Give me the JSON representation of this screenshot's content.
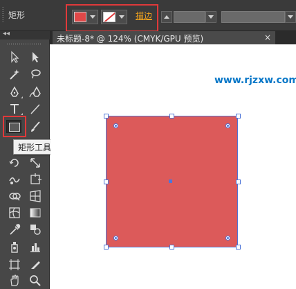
{
  "control_bar": {
    "tool_name": "矩形",
    "fill_color": "#e04848",
    "stroke": "none",
    "stroke_label": "描边"
  },
  "document_tab": {
    "title": "未标题-8* @ 124% (CMYK/GPU 预览)",
    "close": "×"
  },
  "tools_panel": {
    "collapse_glyph": "◂◂",
    "active_tool": "rectangle-tool",
    "tooltip": "矩形工具 (M)"
  },
  "canvas": {
    "watermark": "www.rjzxw.com",
    "shape": {
      "type": "rectangle",
      "fill": "#dc5a5a",
      "selection_color": "#4f76d8",
      "selected": true
    }
  },
  "colors": {
    "ui_dark": "#3a3a3a",
    "panel": "#474747",
    "highlight": "#e0393a",
    "stroke_label": "#f0a21e"
  }
}
